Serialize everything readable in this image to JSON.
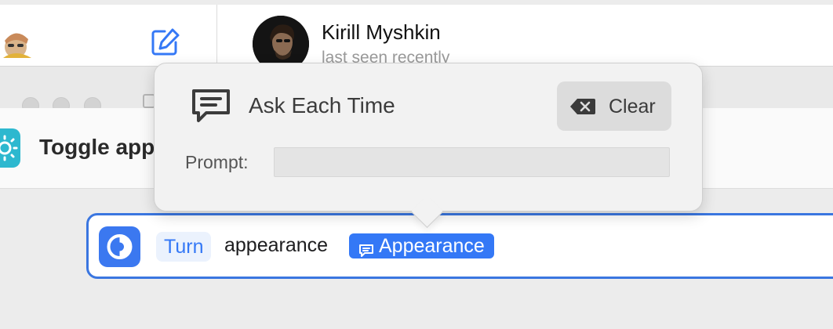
{
  "background_chat": {
    "contact_name": "Kirill Myshkin",
    "contact_status": "last seen recently",
    "compose_icon": "compose-icon"
  },
  "shortcut": {
    "title": "Toggle appearance",
    "icon": "sun-icon"
  },
  "action": {
    "verb_token": "Turn",
    "text": "appearance",
    "variable_token": "Appearance",
    "variable_icon": "speech-bubble-icon"
  },
  "popover": {
    "title": "Ask Each Time",
    "icon": "speech-bubble-icon",
    "clear_button": "Clear",
    "prompt_label": "Prompt:",
    "prompt_value": ""
  },
  "colors": {
    "accent": "#3478f6",
    "shortcut_icon": "#2db8cf"
  }
}
